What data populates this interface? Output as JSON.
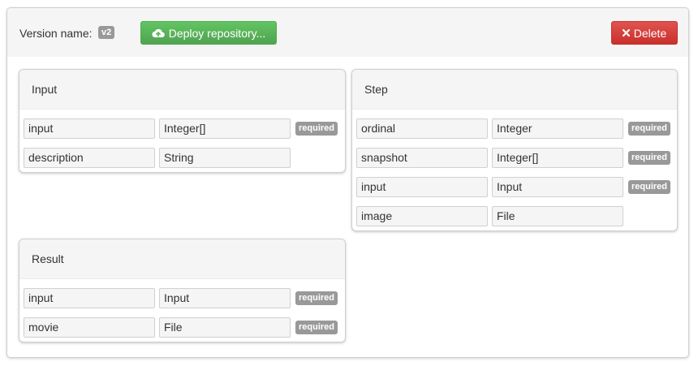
{
  "header": {
    "version_label": "Version name:",
    "version_value": "v2",
    "deploy_label": "Deploy repository...",
    "delete_label": "Delete",
    "colors": {
      "deploy": "#5cb85c",
      "delete": "#d9534f"
    }
  },
  "panels": {
    "input": {
      "title": "Input",
      "fields": [
        {
          "name": "input",
          "type": "Integer[]",
          "required": "required"
        },
        {
          "name": "description",
          "type": "String",
          "required": ""
        }
      ]
    },
    "step": {
      "title": "Step",
      "fields": [
        {
          "name": "ordinal",
          "type": "Integer",
          "required": "required"
        },
        {
          "name": "snapshot",
          "type": "Integer[]",
          "required": "required"
        },
        {
          "name": "input",
          "type": "Input",
          "required": "required"
        },
        {
          "name": "image",
          "type": "File",
          "required": ""
        }
      ]
    },
    "result": {
      "title": "Result",
      "fields": [
        {
          "name": "input",
          "type": "Input",
          "required": "required"
        },
        {
          "name": "movie",
          "type": "File",
          "required": "required"
        }
      ]
    }
  },
  "icons": {
    "deploy": "cloud-upload-icon",
    "delete": "close-icon"
  }
}
